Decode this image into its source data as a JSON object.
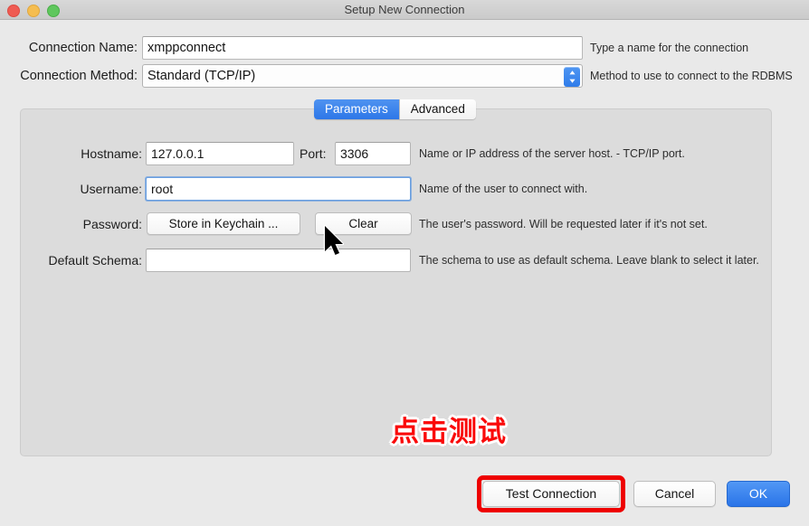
{
  "window": {
    "title": "Setup New Connection",
    "traffic_lights": [
      "close-button",
      "minimize-button",
      "maximize-button"
    ]
  },
  "top_form": {
    "rows": [
      {
        "label": "Connection Name:",
        "value": "xmppconnect",
        "placeholder": "",
        "help": "Type a name for the connection",
        "type": "text"
      },
      {
        "label": "Connection Method:",
        "value": "Standard (TCP/IP)",
        "help": "Method to use to connect to the RDBMS",
        "type": "combo"
      }
    ]
  },
  "tabs": [
    {
      "label": "Parameters",
      "active": true
    },
    {
      "label": "Advanced",
      "active": false
    }
  ],
  "parameters": {
    "hostname": {
      "label": "Hostname:",
      "value": "127.0.0.1",
      "help": "Name or IP address of the server host. - TCP/IP port."
    },
    "port": {
      "label": "Port:",
      "value": "3306"
    },
    "username": {
      "label": "Username:",
      "value": "root",
      "help": "Name of the user to connect with.",
      "focused": true
    },
    "password": {
      "label": "Password:",
      "store_button": "Store in Keychain ...",
      "clear_button": "Clear",
      "help": "The user's password. Will be requested later if it's not set."
    },
    "default_schema": {
      "label": "Default Schema:",
      "value": "",
      "placeholder": "",
      "help": "The schema to use as default schema. Leave blank to select it later."
    }
  },
  "annotation": {
    "text": "点击测试",
    "color": "#fa0a0a",
    "outline_color": "#ffffff"
  },
  "footer": {
    "test_connection": "Test Connection",
    "cancel": "Cancel",
    "ok": "OK",
    "highlight_color": "#ee0000",
    "primary_color": "#2a74e8"
  }
}
